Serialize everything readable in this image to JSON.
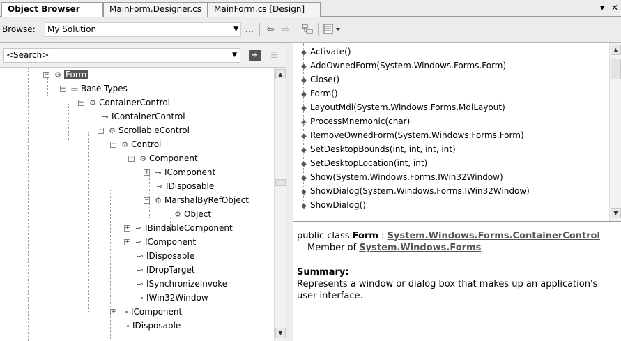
{
  "tabs": [
    {
      "label": "Object Browser",
      "active": true
    },
    {
      "label": "MainForm.Designer.cs",
      "active": false
    },
    {
      "label": "MainForm.cs [Design]",
      "active": false
    }
  ],
  "tab_controls": {
    "dropdown": "▾",
    "close": "✕"
  },
  "toolbar": {
    "browse_label": "Browse:",
    "browse_value": "My Solution",
    "more_label": "...",
    "back_icon": "⇦",
    "forward_icon": "⇨"
  },
  "search": {
    "placeholder": "<Search>"
  },
  "tree": [
    {
      "text": "Form",
      "selected": true
    },
    {
      "text": "Base Types"
    },
    {
      "text": "ContainerControl"
    },
    {
      "text": "IContainerControl"
    },
    {
      "text": "ScrollableControl"
    },
    {
      "text": "Control"
    },
    {
      "text": "Component"
    },
    {
      "text": "IComponent"
    },
    {
      "text": "IDisposable"
    },
    {
      "text": "MarshalByRefObject"
    },
    {
      "text": "Object"
    },
    {
      "text": "IBindableComponent"
    },
    {
      "text": "IComponent"
    },
    {
      "text": "IDisposable"
    },
    {
      "text": "IDropTarget"
    },
    {
      "text": "ISynchronizeInvoke"
    },
    {
      "text": "IWin32Window"
    },
    {
      "text": "IComponent"
    },
    {
      "text": "IDisposable"
    }
  ],
  "members": [
    "Activate()",
    "AddOwnedForm(System.Windows.Forms.Form)",
    "Close()",
    "Form()",
    "LayoutMdi(System.Windows.Forms.MdiLayout)",
    "ProcessMnemonic(char)",
    "RemoveOwnedForm(System.Windows.Forms.Form)",
    "SetDesktopBounds(int, int, int, int)",
    "SetDesktopLocation(int, int)",
    "Show(System.Windows.Forms.IWin32Window)",
    "ShowDialog(System.Windows.Forms.IWin32Window)",
    "ShowDialog()"
  ],
  "description": {
    "decl_prefix": "public class ",
    "class_name": "Form",
    "decl_sep": " : ",
    "base_link": "System.Windows.Forms.ContainerControl",
    "member_of": "Member of ",
    "namespace_link": "System.Windows.Forms",
    "summary_heading": "Summary:",
    "summary_line1": "Represents a window or dialog box that makes up an application's",
    "summary_line2": "user interface."
  }
}
